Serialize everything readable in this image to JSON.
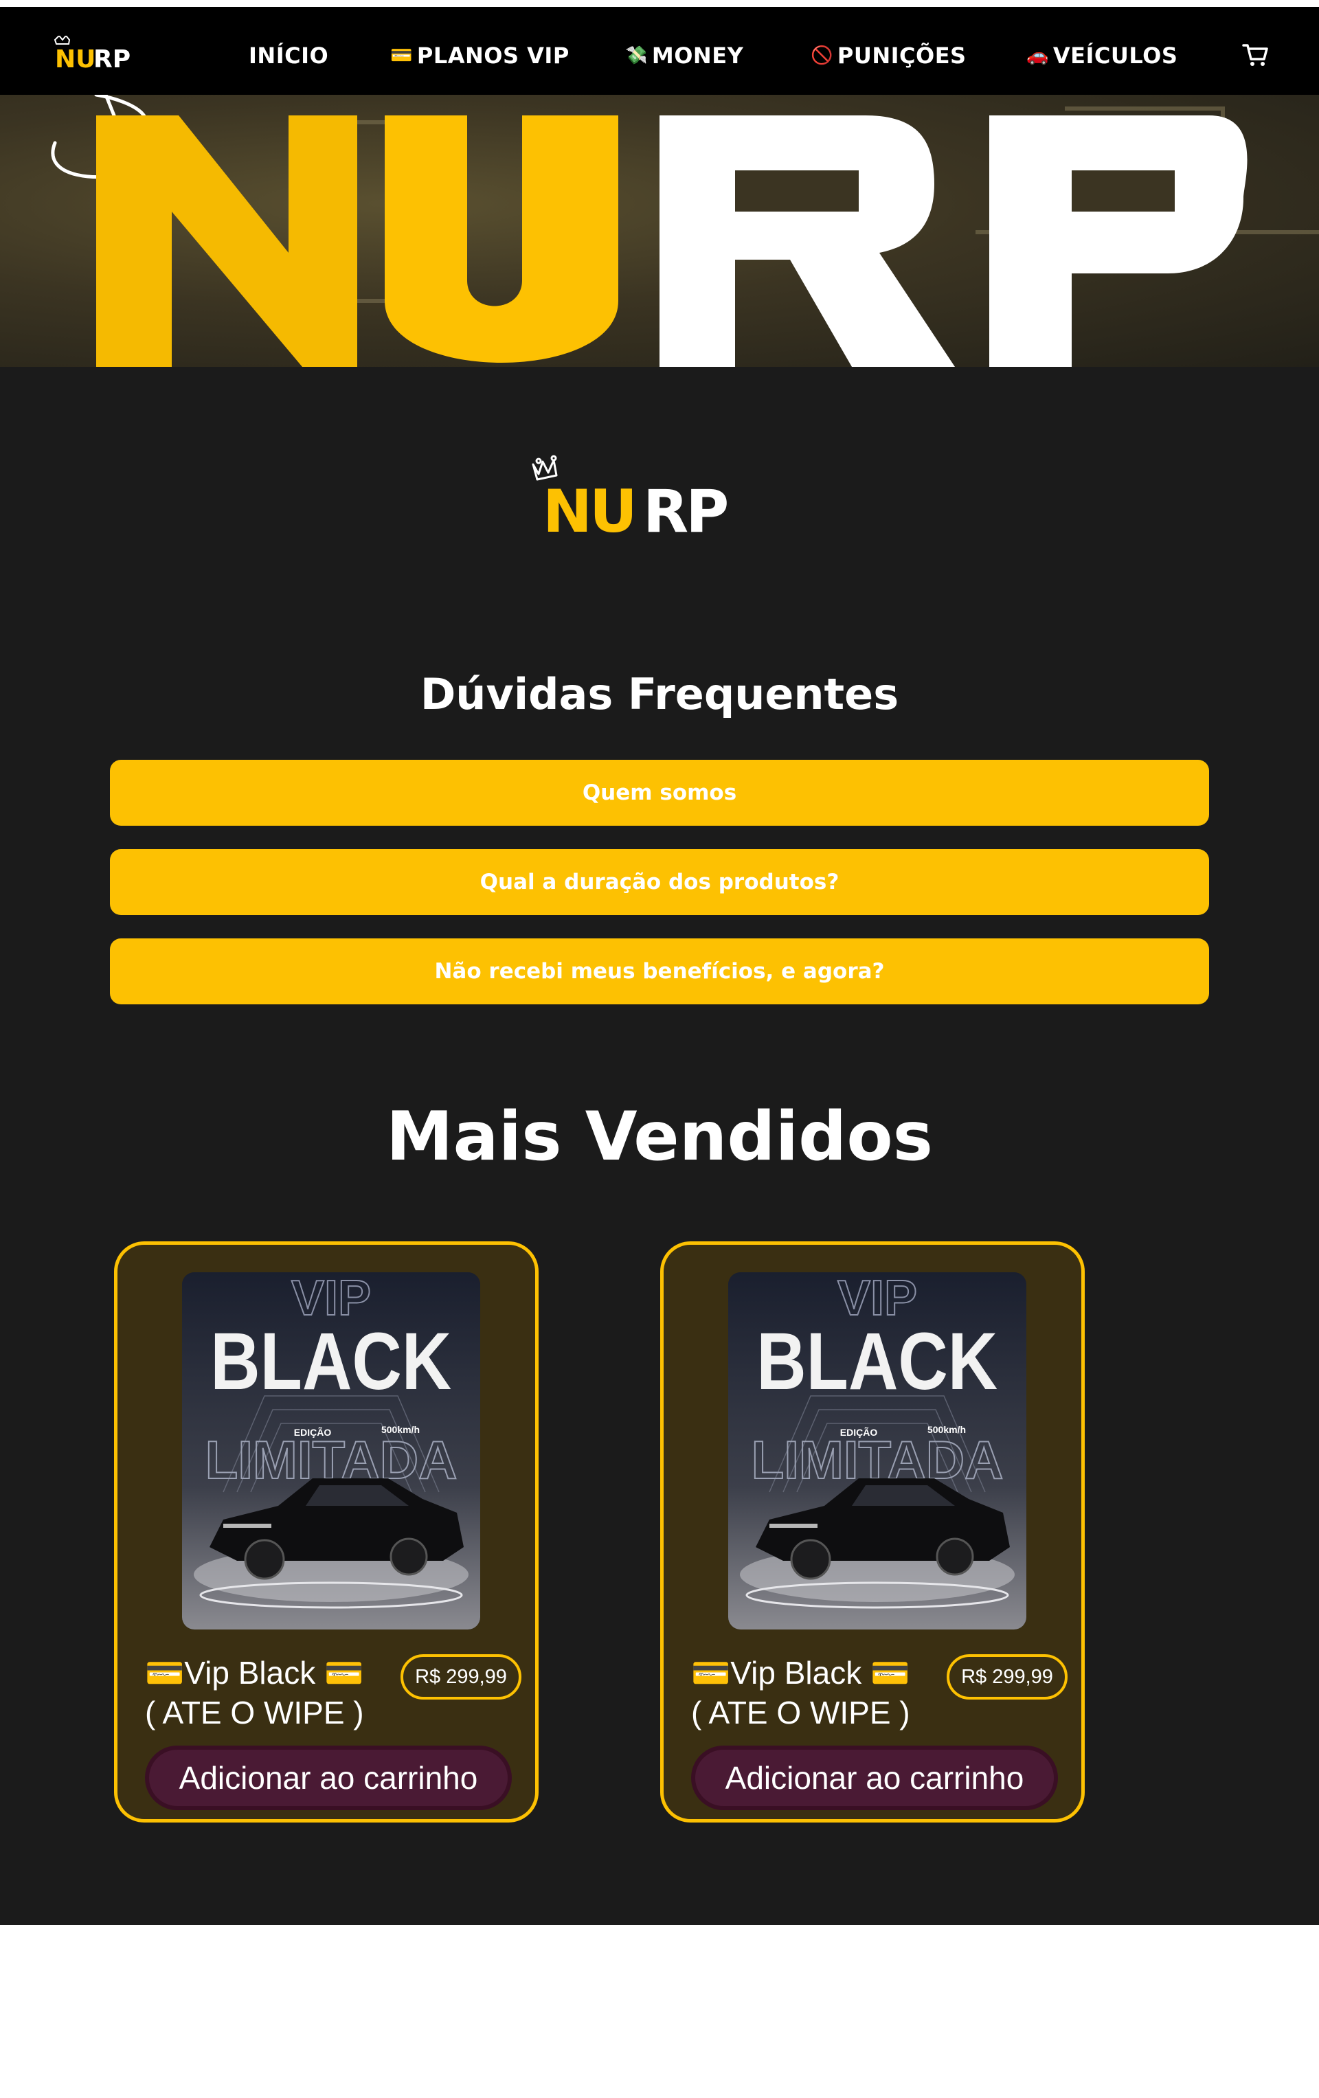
{
  "brand": {
    "logo_text": "NURP",
    "logo_part1": "NU",
    "logo_part2": "RP",
    "accent": "#fdc102"
  },
  "nav": {
    "items": [
      {
        "icon": "home",
        "label": "INÍCIO"
      },
      {
        "icon": "💳",
        "label": "PLANOS VIP"
      },
      {
        "icon": "💸",
        "label": "MONEY"
      },
      {
        "icon": "🚫",
        "label": "PUNIÇÕES"
      },
      {
        "icon": "🚗",
        "label": "VEÍCULOS"
      }
    ],
    "cart_icon": "cart-icon"
  },
  "faq": {
    "title": "Dúvidas Frequentes",
    "items": [
      "Quem somos",
      "Qual a duração dos produtos?",
      "Não recebi meus benefícios, e agora?"
    ]
  },
  "best_sellers": {
    "title": "Mais Vendidos",
    "products": [
      {
        "image_text": {
          "top": "VIP",
          "main": "BLACK",
          "edition": "EDIÇÃO",
          "speed": "500km/h",
          "bottom": "LIMITADA"
        },
        "name_line1": "💳Vip Black 💳",
        "name_line2": "( ATE O WIPE )",
        "price": "R$ 299,99",
        "add_label": "Adicionar ao carrinho"
      },
      {
        "image_text": {
          "top": "VIP",
          "main": "BLACK",
          "edition": "EDIÇÃO",
          "speed": "500km/h",
          "bottom": "LIMITADA"
        },
        "name_line1": "💳Vip Black 💳",
        "name_line2": "( ATE O WIPE )",
        "price": "R$ 299,99",
        "add_label": "Adicionar ao carrinho"
      }
    ]
  }
}
